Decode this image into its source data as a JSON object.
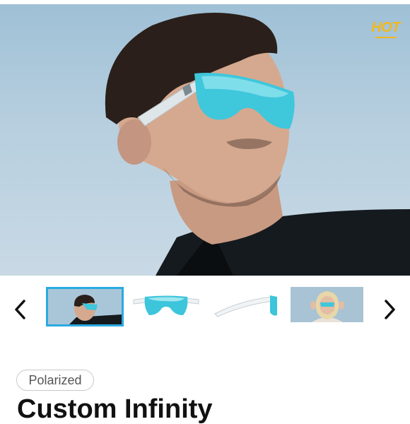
{
  "hero": {
    "image_alt": "man-wearing-blue-mirrored-sunglasses",
    "logo_text": "HOT"
  },
  "gallery": {
    "prev_icon": "chevron-left-icon",
    "next_icon": "chevron-right-icon",
    "thumbnails": [
      {
        "name": "model-man-photo",
        "selected": true
      },
      {
        "name": "sunglasses-front-view",
        "selected": false
      },
      {
        "name": "sunglasses-side-view",
        "selected": false
      },
      {
        "name": "model-woman-photo",
        "selected": false
      }
    ],
    "accent_color": "#29aae1"
  },
  "product": {
    "badge": "Polarized",
    "title": "Custom Infinity"
  }
}
